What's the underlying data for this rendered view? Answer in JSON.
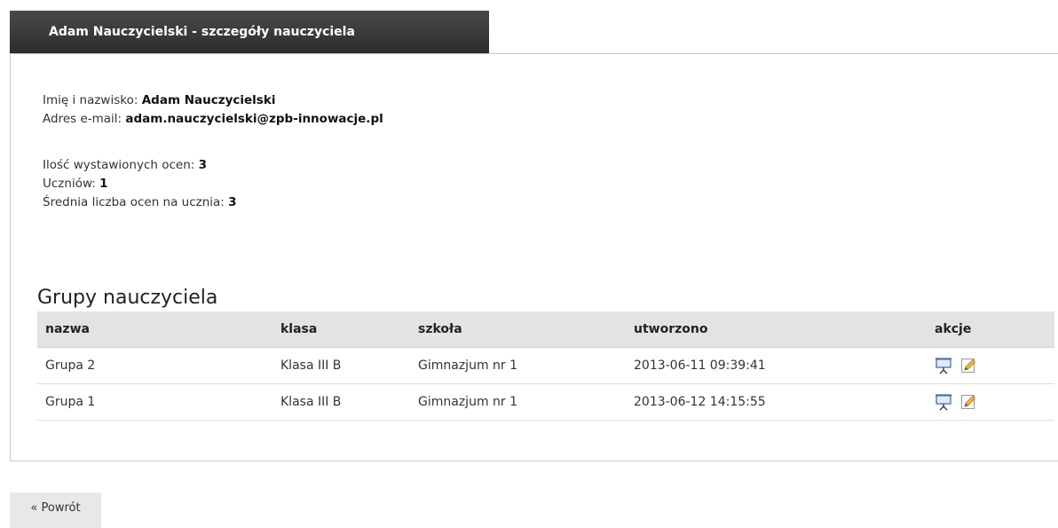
{
  "header": {
    "title": "Adam Nauczycielski - szczegóły nauczyciela"
  },
  "teacher": {
    "name_label": "Imię i nazwisko:",
    "name": "Adam Nauczycielski",
    "email_label": "Adres e-mail:",
    "email": "adam.nauczycielski@zpb-innowacje.pl"
  },
  "stats": {
    "grades_label": "Ilość wystawionych ocen:",
    "grades": "3",
    "students_label": "Uczniów:",
    "students": "1",
    "avg_label": "Średnia liczba ocen na ucznia:",
    "avg": "3"
  },
  "groups": {
    "title": "Grupy nauczyciela",
    "columns": [
      "nazwa",
      "klasa",
      "szkoła",
      "utworzono",
      "akcje"
    ],
    "rows": [
      {
        "name": "Grupa 2",
        "class": "Klasa III B",
        "school": "Gimnazjum nr 1",
        "created": "2013-06-11 09:39:41"
      },
      {
        "name": "Grupa 1",
        "class": "Klasa III B",
        "school": "Gimnazjum nr 1",
        "created": "2013-06-12 14:15:55"
      }
    ],
    "row_actions": [
      "presentation-icon",
      "edit-icon"
    ]
  },
  "footer": {
    "back_label": "« Powrót"
  },
  "colors": {
    "header_bg": "#353535",
    "header_text": "#ffffff",
    "table_header_bg": "#e3e3e3",
    "button_bg": "#e8e8e8"
  }
}
